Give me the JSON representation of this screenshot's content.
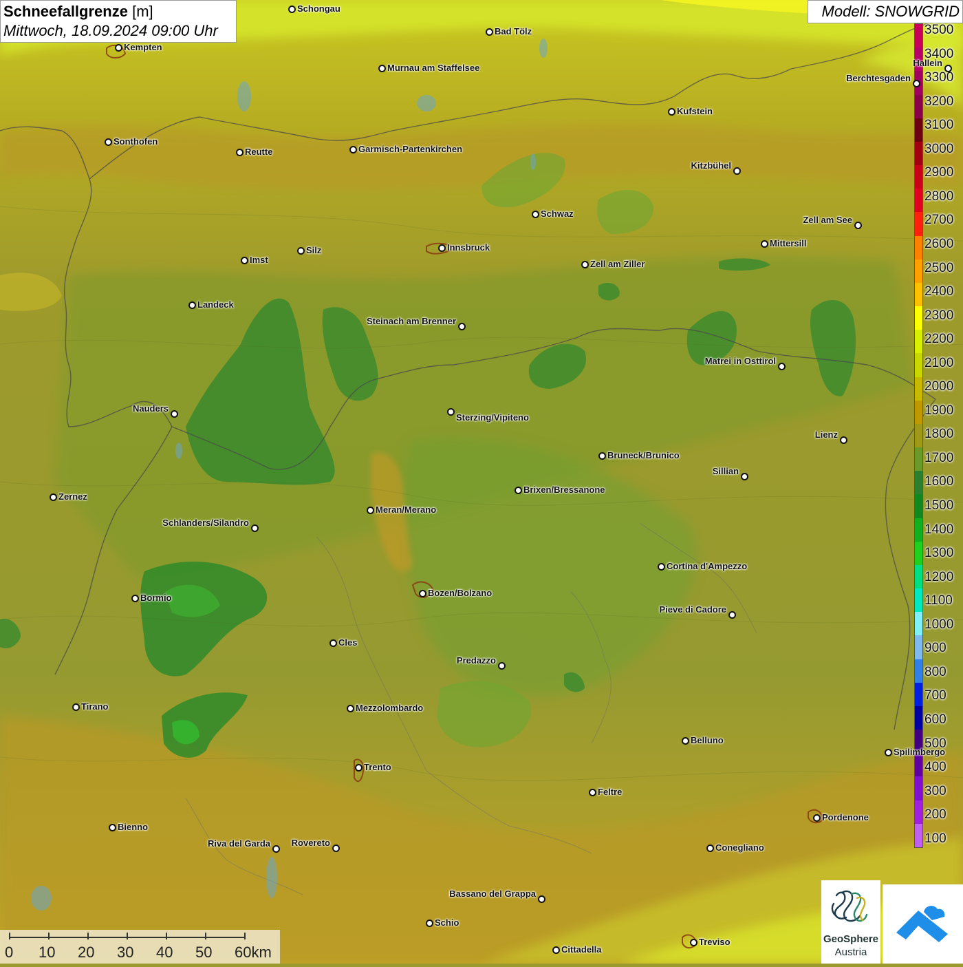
{
  "title": {
    "main": "Schneefallgrenze",
    "unit": "[m]",
    "datetime": "Mittwoch, 18.09.2024 09:00 Uhr"
  },
  "model": "Modell: SNOWGRID",
  "legend": {
    "labels": [
      "3500",
      "3400",
      "3300",
      "3200",
      "3100",
      "3000",
      "2900",
      "2800",
      "2700",
      "2600",
      "2500",
      "2400",
      "2300",
      "2200",
      "2100",
      "2000",
      "1900",
      "1800",
      "1700",
      "1600",
      "1500",
      "1400",
      "1300",
      "1200",
      "1100",
      "1000",
      "900",
      "800",
      "700",
      "600",
      "500",
      "400",
      "300",
      "200",
      "100"
    ],
    "colors": [
      "#c8005a",
      "#b8006a",
      "#a00060",
      "#88004a",
      "#6a0010",
      "#a00010",
      "#c80018",
      "#e00020",
      "#ff2010",
      "#ff8000",
      "#ffa000",
      "#ffc000",
      "#ffff00",
      "#d8f000",
      "#c8d800",
      "#c8b800",
      "#c09800",
      "#a09818",
      "#6a9a28",
      "#2a8030",
      "#108a20",
      "#10b020",
      "#20d020",
      "#00e080",
      "#00e8c0",
      "#80f0f8",
      "#80b8f0",
      "#3080e8",
      "#0020e0",
      "#0000a0",
      "#400080",
      "#6000a0",
      "#8010d0",
      "#a020e0",
      "#c060f0"
    ]
  },
  "cities": [
    {
      "name": "Schongau"
    },
    {
      "name": "Bad Tölz"
    },
    {
      "name": "Kempten"
    },
    {
      "name": "Murnau am Staffelsee"
    },
    {
      "name": "Hallein"
    },
    {
      "name": "Berchtesgaden"
    },
    {
      "name": "Kufstein"
    },
    {
      "name": "Sonthofen"
    },
    {
      "name": "Reutte"
    },
    {
      "name": "Garmisch-Partenkirchen"
    },
    {
      "name": "Kitzbühel"
    },
    {
      "name": "Schwaz"
    },
    {
      "name": "Zell am See"
    },
    {
      "name": "Innsbruck"
    },
    {
      "name": "Mittersill"
    },
    {
      "name": "Imst"
    },
    {
      "name": "Silz"
    },
    {
      "name": "Zell am Ziller"
    },
    {
      "name": "Landeck"
    },
    {
      "name": "Steinach am Brenner"
    },
    {
      "name": "Matrei in Osttirol"
    },
    {
      "name": "Nauders"
    },
    {
      "name": "Sterzing/Vipiteno"
    },
    {
      "name": "Lienz"
    },
    {
      "name": "Bruneck/Brunico"
    },
    {
      "name": "Sillian"
    },
    {
      "name": "Zernez"
    },
    {
      "name": "Brixen/Bressanone"
    },
    {
      "name": "Meran/Merano"
    },
    {
      "name": "Schlanders/Silandro"
    },
    {
      "name": "Cortina d'Ampezzo"
    },
    {
      "name": "Bozen/Bolzano"
    },
    {
      "name": "Bormio"
    },
    {
      "name": "Pieve di Cadore"
    },
    {
      "name": "Cles"
    },
    {
      "name": "Predazzo"
    },
    {
      "name": "Tirano"
    },
    {
      "name": "Mezzolombardo"
    },
    {
      "name": "Belluno"
    },
    {
      "name": "Spilimbergo"
    },
    {
      "name": "Trento"
    },
    {
      "name": "Feltre"
    },
    {
      "name": "Pordenone"
    },
    {
      "name": "Bienno"
    },
    {
      "name": "Riva del Garda"
    },
    {
      "name": "Rovereto"
    },
    {
      "name": "Conegliano"
    },
    {
      "name": "Bassano del Grappa"
    },
    {
      "name": "Schio"
    },
    {
      "name": "Treviso"
    },
    {
      "name": "Cittadella"
    }
  ],
  "scale": {
    "labels": [
      "0",
      "10",
      "20",
      "30",
      "40",
      "50",
      "60km"
    ]
  },
  "logo": {
    "line1": "GeoSphere",
    "line2": "Austria"
  }
}
